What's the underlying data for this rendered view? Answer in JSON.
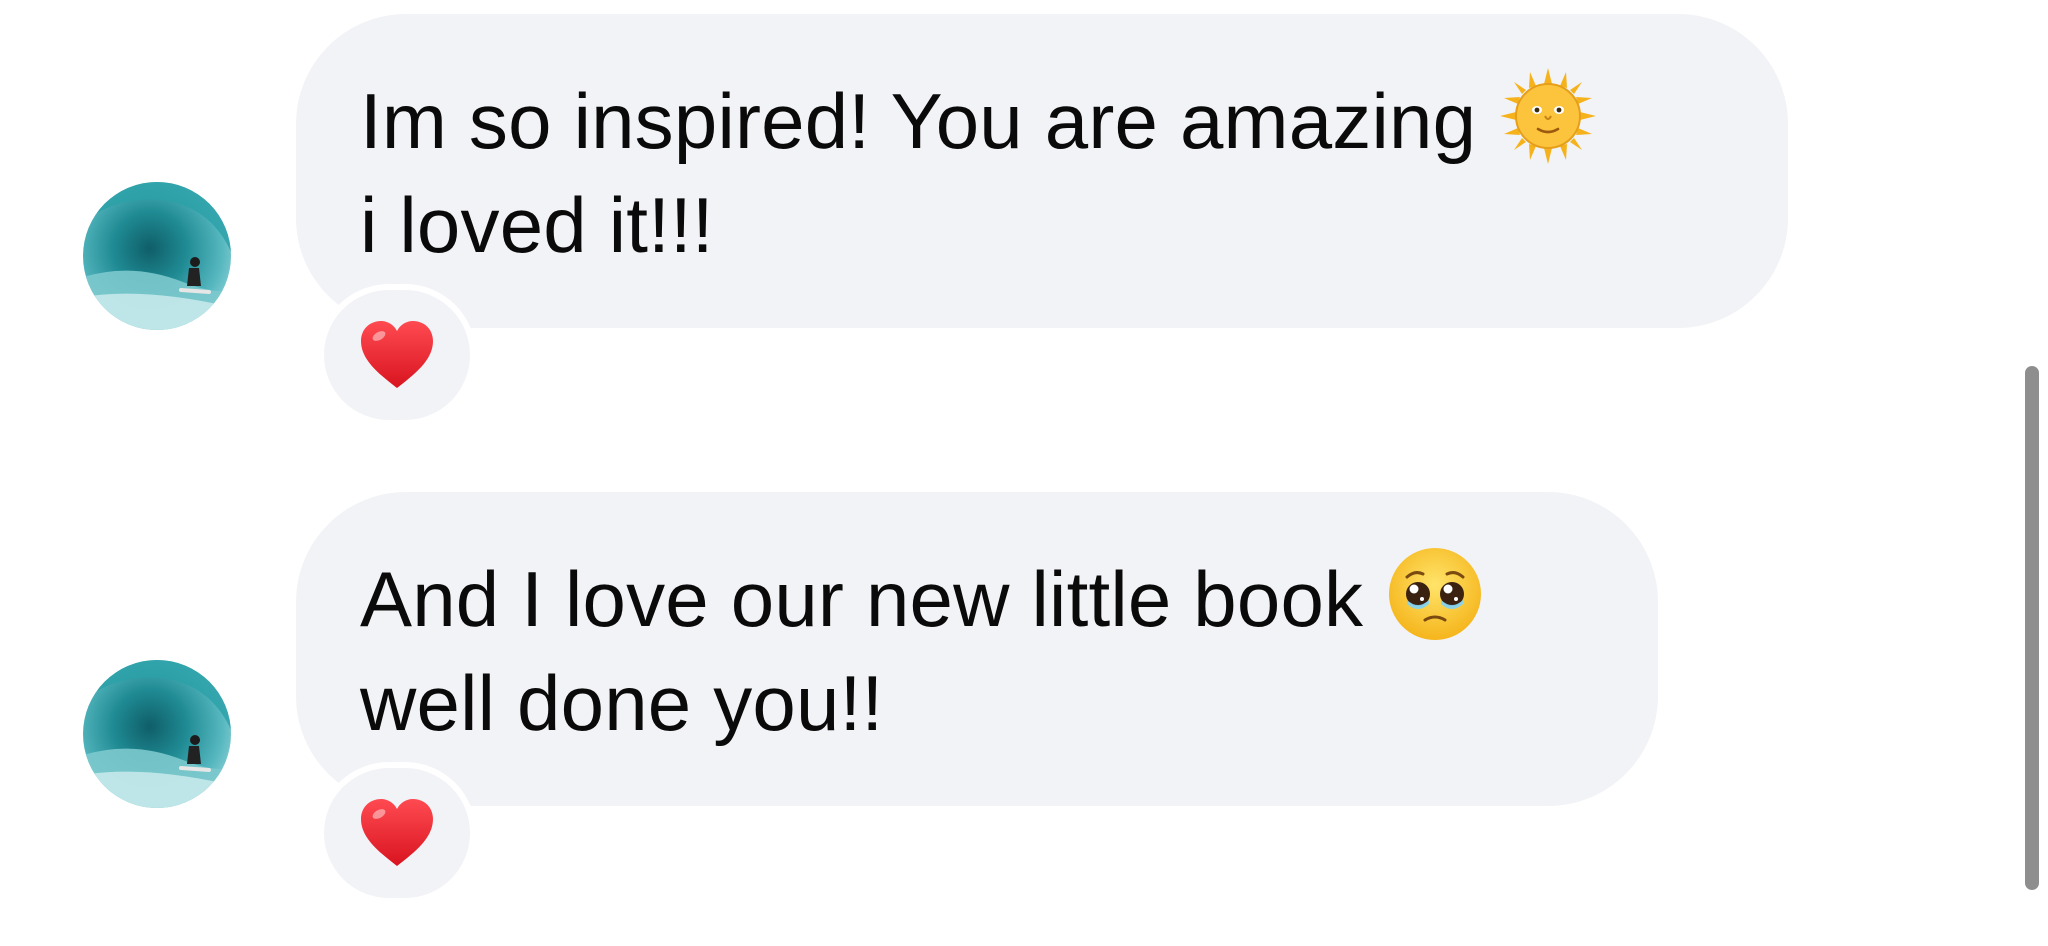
{
  "messages": [
    {
      "lines": [
        "Im so inspired! You are amazing",
        "i loved it!!!"
      ],
      "emoji": "sun-with-face-icon",
      "reaction": "red-heart-icon"
    },
    {
      "lines": [
        "And I love our new little book",
        "well done you!!"
      ],
      "emoji": "pleading-face-icon",
      "reaction": "red-heart-icon"
    }
  ],
  "colors": {
    "bubble": "#f2f3f6",
    "text": "#0a0a0a",
    "heart": "#e8252f",
    "scrollbar": "#8e8e8e"
  }
}
